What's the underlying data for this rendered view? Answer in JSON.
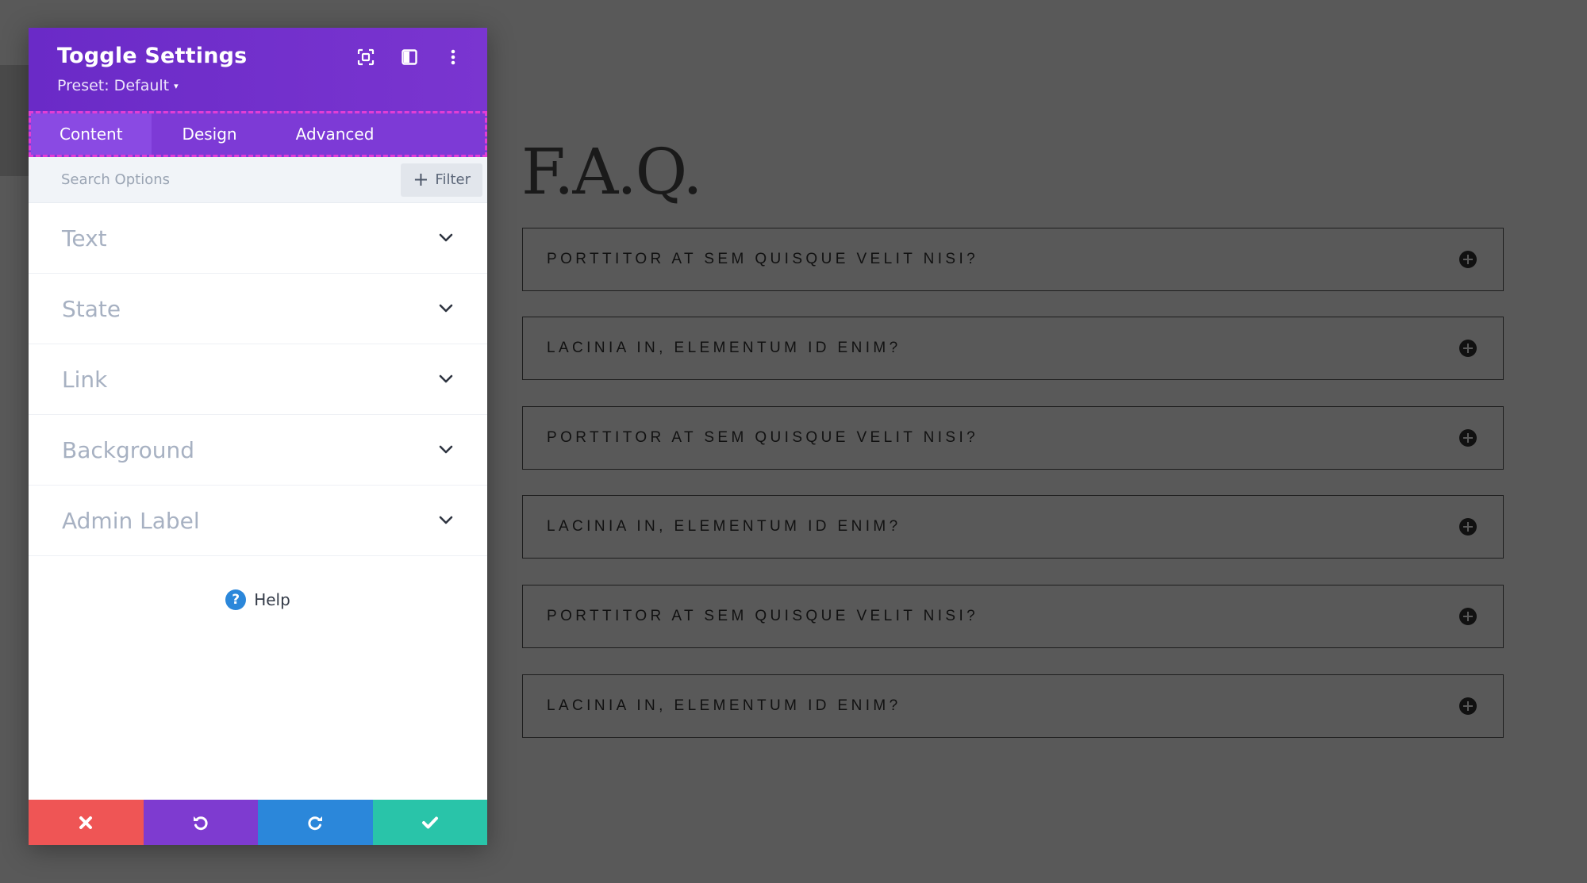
{
  "panel": {
    "title": "Toggle Settings",
    "preset": "Preset: Default",
    "header_icons": [
      "focus-icon",
      "split-view-icon",
      "more-vertical-icon"
    ],
    "tabs": [
      {
        "label": "Content",
        "active": true
      },
      {
        "label": "Design",
        "active": false
      },
      {
        "label": "Advanced",
        "active": false
      }
    ],
    "search": {
      "placeholder": "Search Options",
      "value": ""
    },
    "filter_label": "Filter",
    "groups": [
      {
        "label": "Text"
      },
      {
        "label": "State"
      },
      {
        "label": "Link"
      },
      {
        "label": "Background"
      },
      {
        "label": "Admin Label"
      }
    ],
    "help_label": "Help",
    "help_icon_glyph": "?",
    "actions": [
      "close-icon",
      "undo-icon",
      "redo-icon",
      "check-icon"
    ],
    "colors": {
      "header": "#6c2bc9",
      "tabs": "#7d3ad6",
      "cancel": "#ef5555",
      "undo": "#7e3bd0",
      "redo": "#2b87da",
      "save": "#29c4a9"
    }
  },
  "page": {
    "heading": "F.A.Q.",
    "toggles": [
      {
        "title": "PORTTITOR AT SEM QUISQUE VELIT NISI?"
      },
      {
        "title": "LACINIA IN, ELEMENTUM ID ENIM?"
      },
      {
        "title": "PORTTITOR AT SEM QUISQUE VELIT NISI?"
      },
      {
        "title": "LACINIA IN, ELEMENTUM ID ENIM?"
      },
      {
        "title": "PORTTITOR AT SEM QUISQUE VELIT NISI?"
      },
      {
        "title": "LACINIA IN, ELEMENTUM ID ENIM?"
      }
    ]
  }
}
